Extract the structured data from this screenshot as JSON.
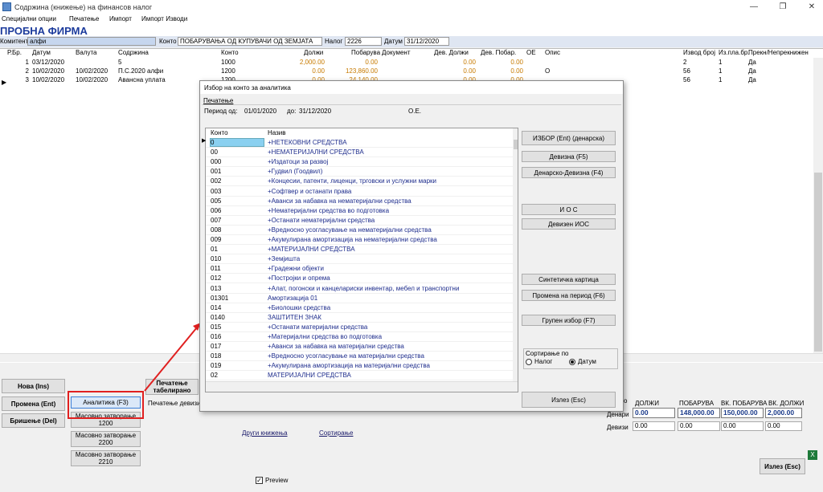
{
  "window": {
    "title": "Содржина (книжење) на финансов налог"
  },
  "menu": [
    "Специјални опции",
    "Печатење",
    "Импорт",
    "Импорт Изводи"
  ],
  "firm": "ПРОБНА ФИРМА",
  "info": {
    "komintent_label": "Комитент",
    "komintent_value": "алфи",
    "konto_label": "Конто",
    "konto_value": "ПОБАРУВАЊА ОД КУПУВАЧИ ОД ЗЕМЈАТА",
    "nalog_label": "Налог",
    "nalog_value": "2226",
    "datum_label": "Датум",
    "datum_value": "31/12/2020"
  },
  "grid": {
    "headers": [
      "Р.Бр.",
      "Датум",
      "Валута",
      "Содржина",
      "Конто",
      "Должи",
      "Побарува",
      "Документ",
      "Дев. Должи",
      "Дев. Побар.",
      "ОЕ",
      "Опис",
      "Извод број",
      "Из.пла.бр.",
      "Прекн/Непрекнижен"
    ],
    "rows": [
      {
        "rb": "1",
        "datum": "03/12/2020",
        "valuta": "",
        "sodrzina": "5",
        "konto": "1000",
        "dolzi": "2,000.00",
        "pobaruva": "0.00",
        "dokument": "",
        "dev_dolzi": "0.00",
        "dev_pobar": "0.00",
        "oe": "",
        "opis": "",
        "izvod": "2",
        "izpla": "1",
        "prekn": "Да"
      },
      {
        "rb": "2",
        "datum": "10/02/2020",
        "valuta": "10/02/2020",
        "sodrzina": "П.С.2020 алфи",
        "konto": "1200",
        "dolzi": "0.00",
        "pobaruva": "123,860.00",
        "dokument": "",
        "dev_dolzi": "0.00",
        "dev_pobar": "0.00",
        "oe": "",
        "opis": "О",
        "izvod": "56",
        "izpla": "1",
        "prekn": "Да"
      },
      {
        "rb": "3",
        "datum": "10/02/2020",
        "valuta": "10/02/2020",
        "sodrzina": "Авансна уплата",
        "konto": "1200",
        "dolzi": "0.00",
        "pobaruva": "24,140.00",
        "dokument": "",
        "dev_dolzi": "0.00",
        "dev_pobar": "0.00",
        "oe": "",
        "opis": "",
        "izvod": "56",
        "izpla": "1",
        "prekn": "Да"
      }
    ]
  },
  "buttons": {
    "nova": "Нова (Ins)",
    "promena": "Промена (Ent)",
    "brisenje": "Бришење (Del)",
    "analitika": "Аналитика (F3)",
    "masovno_1200": "Масовно затворање 1200",
    "masovno_2200": "Масовно затворање 2200",
    "masovno_2210": "Масовно затворање 2210",
    "pecatenje_tab": "Печатење табелирано",
    "pecatenje_dev": "Печатење девизи",
    "izlez": "Излез (Esc)"
  },
  "links": {
    "drugi": "Други книжења",
    "sortiranje": "Сортирање"
  },
  "preview_label": "Preview",
  "totals": {
    "dolzi_h": "ДОЛЖИ",
    "pobaruva_h": "ПОБАРУВА",
    "vk_pobaruva_h": "ВК. ПОБАРУВА",
    "vk_dolzi_h": "ВК. ДОЛЖИ",
    "o_label": "о",
    "denari_label": "Денари",
    "devizi_label": "Девизи",
    "denari": [
      "0.00",
      "148,000.00",
      "150,000.00",
      "2,000.00"
    ],
    "devizi": [
      "0.00",
      "0.00",
      "0.00",
      "0.00"
    ]
  },
  "dialog": {
    "title": "Избор на конто за аналитика",
    "menu": "Печатење",
    "period_label": "Период од:",
    "period_from": "01/01/2020",
    "period_to_label": "до:",
    "period_to": "31/12/2020",
    "oe_label": "О.Е.",
    "col_konto": "Конто",
    "col_naziv": "Назив",
    "rows": [
      {
        "k": "0",
        "n": "+НЕТЕКОВНИ СРЕДСТВА"
      },
      {
        "k": "00",
        "n": "+НЕМАТЕРИЈАЛНИ СРЕДСТВА"
      },
      {
        "k": "000",
        "n": "+Издатоци за развој"
      },
      {
        "k": "001",
        "n": "+Гудвил (Гоодвил)"
      },
      {
        "k": "002",
        "n": "+Концесии, патенти, лиценци, трговски и услужни марки"
      },
      {
        "k": "003",
        "n": "+Софтвер и останати права"
      },
      {
        "k": "005",
        "n": "+Аванси за набавка на нематеријални средства"
      },
      {
        "k": "006",
        "n": "+Нематеријални средства во подготовка"
      },
      {
        "k": "007",
        "n": "+Останати нематеријални средства"
      },
      {
        "k": "008",
        "n": "+Вредносно усогласување на нематеријални средства"
      },
      {
        "k": "009",
        "n": "+Акумулирана амортизација на нематеријални средства"
      },
      {
        "k": "01",
        "n": "+МАТЕРИЈАЛНИ СРЕДСТВА"
      },
      {
        "k": "010",
        "n": "+Земјишта"
      },
      {
        "k": "011",
        "n": "+Градежни објекти"
      },
      {
        "k": "012",
        "n": "+Постројки и опрема"
      },
      {
        "k": "013",
        "n": "+Алат, погонски и канцелариски инвентар, мебел и транспортни"
      },
      {
        "k": "01301",
        "n": "Амортизација 01"
      },
      {
        "k": "014",
        "n": "+Биолошки средства"
      },
      {
        "k": "0140",
        "n": "ЗАШТИТЕН ЗНАК"
      },
      {
        "k": "015",
        "n": "+Останати материјални средства"
      },
      {
        "k": "016",
        "n": "+Материјални средства во подготовка"
      },
      {
        "k": "017",
        "n": "+Аванси за набавка на материјални средства"
      },
      {
        "k": "018",
        "n": "+Вредносно усогласување на материјални средства"
      },
      {
        "k": "019",
        "n": "+Акумулирана амортизација на материјални средства"
      },
      {
        "k": "02",
        "n": "МАТЕРИЈАЛНИ СРЕДСТВА"
      }
    ],
    "buttons": {
      "izbor": "ИЗБОР (Ent) (денарска)",
      "devizna": "Девизна (F5)",
      "denarsko_devizna": "Денарско-Девизна (F4)",
      "ios": "И О С",
      "devizen_ios": "Девизен ИОС",
      "sintetichka": "Синтетичка картица",
      "promena_period": "Промена на период (F6)",
      "grupen": "Групен избор (F7)",
      "izlez": "Излез (Esc)"
    },
    "sort_label": "Сортирање по",
    "sort_nalog": "Налог",
    "sort_datum": "Датум"
  },
  "colors": {
    "accent": "#1c3b9c",
    "annotation": "#e02020"
  }
}
